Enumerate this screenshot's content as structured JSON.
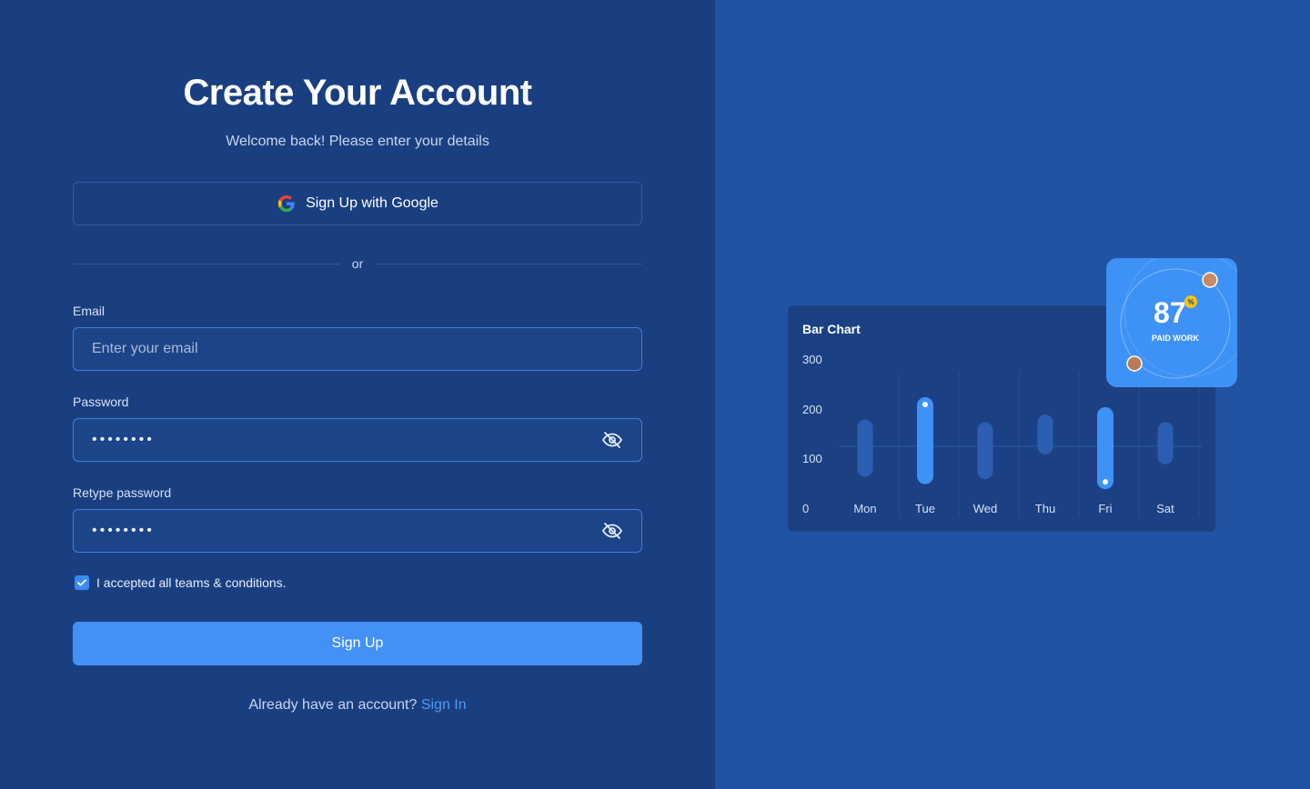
{
  "form": {
    "title": "Create Your Account",
    "subtitle": "Welcome back! Please enter your details",
    "google_button": "Sign Up with Google",
    "divider": "or",
    "email_label": "Email",
    "email_placeholder": "Enter your email",
    "password_label": "Password",
    "password_value": "••••••••",
    "retype_label": "Retype password",
    "retype_value": "••••••••",
    "terms_text": "I accepted all teams & conditions.",
    "terms_checked": true,
    "submit": "Sign Up",
    "signin_prompt": "Already have an account?",
    "signin_link": "Sign In"
  },
  "icons": {
    "google": "google-logo-icon",
    "eye": "eye-off-icon",
    "check": "checkmark-icon"
  },
  "colors": {
    "left_bg": "#1a3f80",
    "right_bg": "#2253a3",
    "accent": "#4391f5",
    "link": "#4a9af8"
  },
  "chart_data": {
    "type": "bar",
    "title": "Bar Chart",
    "categories": [
      "Mon",
      "Tue",
      "Wed",
      "Thu",
      "Fri",
      "Sat"
    ],
    "ranges": [
      [
        65,
        180
      ],
      [
        50,
        225
      ],
      [
        60,
        175
      ],
      [
        110,
        190
      ],
      [
        40,
        205
      ],
      [
        90,
        175
      ]
    ],
    "highlighted": [
      "Tue",
      "Fri"
    ],
    "y_ticks": [
      "300",
      "200",
      "100",
      "0"
    ],
    "ylim": [
      0,
      300
    ]
  },
  "stat_card": {
    "value": "87",
    "caption": "PAID WORK",
    "badge": "%"
  }
}
